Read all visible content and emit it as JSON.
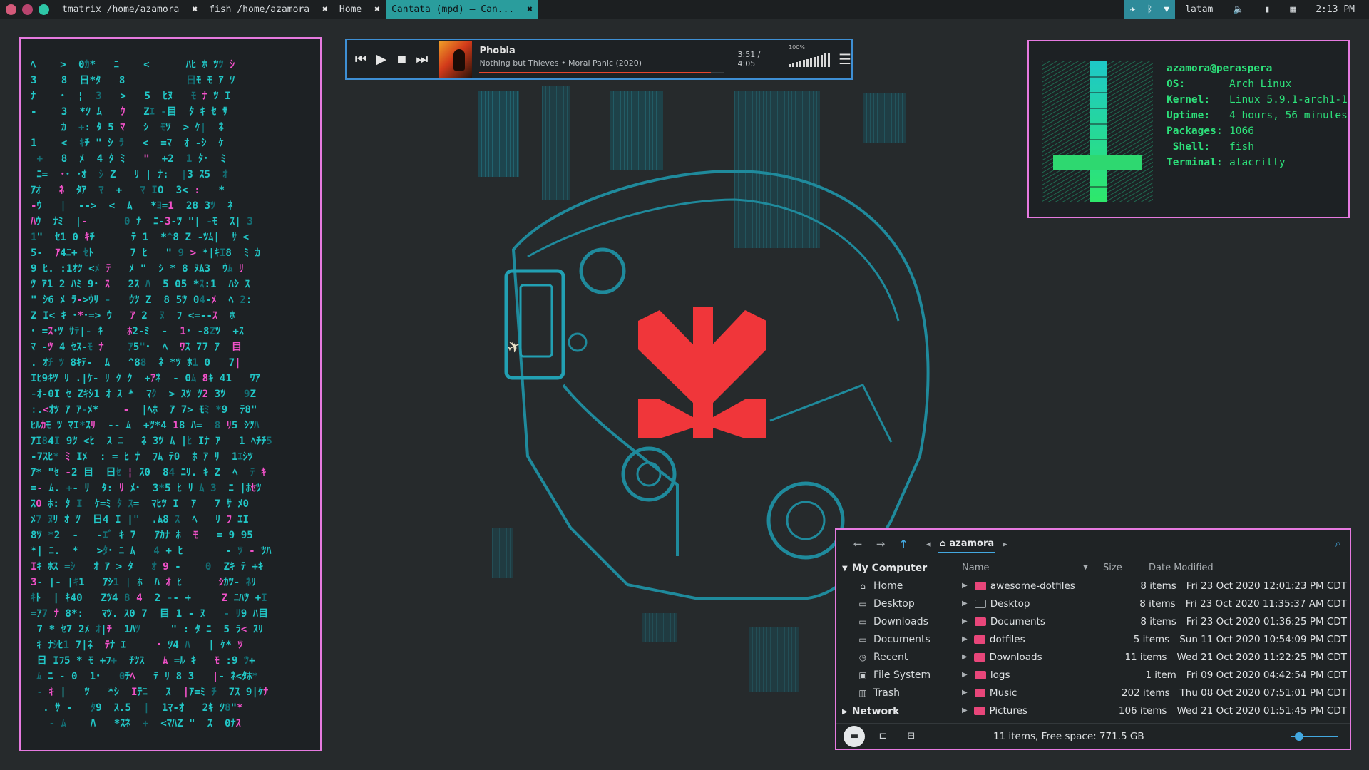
{
  "topbar": {
    "window_dots": [
      "#d45a7a",
      "#b8446e",
      "#2ec7a7"
    ],
    "tabs": [
      {
        "label": "tmatrix /home/azamora",
        "close": "✖",
        "active": false
      },
      {
        "label": "fish /home/azamora",
        "close": "✖",
        "active": false
      },
      {
        "label": "Home",
        "close": "✖",
        "active": false
      },
      {
        "label": "Cantata (mpd) – Can...",
        "close": "✖",
        "active": true
      }
    ],
    "tray": {
      "icons": [
        "telegram-icon",
        "bluetooth-icon",
        "wifi-icon"
      ],
      "keyboard": "latam",
      "time": "2:13 PM"
    }
  },
  "matrix": {
    "rows": [
      "ﾍ    >  0ｶ*   ﾆ    <      ﾊﾋ ﾎ ﾂﾂ ｼ",
      "3    8  日*ﾀ   8          日ﾓ ﾓ ｱ ﾂ",
      "ﾅ    ･  ¦  3   >   5  ﾋﾇ   ﾓ ﾅ ﾂ I",
      "-    3  *ﾂ ﾑ   ｳ   Zｴ -目  ﾀ ｷ ｾ ｻ",
      "     ｶ  +: ﾀ 5 ﾏ   ｼ  ﾓﾂ  > ｹ|  ﾈ",
      "1    <  ｷﾁ \" ｼ ﾗ   <  =ﾏ  ｵ -ｼ  ｹ",
      " +   8  ﾒ  4 ﾀ ﾐ   \"  +2  1 ﾀ･  ﾐ",
      " ﾆ=  ･･ ･ｵ  ｼ Z   ﾘ | ﾅ:  |3 ｽ5  ｵ",
      "ｱｵ   ﾈ  ﾀｱ  ﾏ  +   ﾏ IO  3< :   *",
      "-ｳ   |  -->  <  ﾑ   *ﾖ=1  28 3ﾂ  ﾈ",
      "ﾊｳ  ﾅﾐ  |-      0 ﾅ  ﾆ-3-ﾂ \"| -ﾓ  ｽ| 3",
      "1\"  ｾ1 0 ｷﾁ      ﾃ 1  *^8 Z -ﾂﾑ|  ｻ <",
      "5-  ｱ4ﾆ+ ｾﾄ      7 ﾋ   \" 9 > *|ｷI8  ﾐ ｶ",
      "9 ﾋ. :1ｵﾂ <ﾒ ﾃ   ﾒ \"  ｼ * 8 ﾇﾑ3  ｳﾑ ﾘ",
      "ﾂ ｱ1 2 ﾊﾐ 9･ ｽ   2ｽ ﾊ  5 05 *ｽ:1  ﾊｼ ｽ",
      "\" ｼ6 ﾒ ﾗ->ｳﾘ -   ｳﾂ Z  8 5ﾂ 04-ﾒ  ﾍ 2:",
      "Z I< ｷ ･*･=> ｳ   ｱ 2  ﾇ  ﾌ <=--ｽ  ﾎ",
      "･ =ｽ･ﾂ ｻﾃ|- ｷ    ﾎ2-ﾐ  -  1･ -8Zﾂ  +ｽ",
      "ﾏ -ﾂ 4 ｾｽ-ﾓ ﾅ    ｱ5\"･  ﾍ  ﾜｽ 77 ｱ  目",
      ". ｵﾁ ﾂ 8ｷﾃ-  ﾑ   ^88  ﾈ *ﾂ ﾎ1 0   7|",
      "Iﾋ9ｷﾂ ﾘ .|ｹ- ﾘ ｸ ｸ  +ｱﾈ  - 0ﾑ 8ｷ 41   ﾜｱ",
      "-ｵ-0I ｾ Zｷｼ1 ｵ ｽ *  ﾏｸ  > ｽﾂ ﾂ2 3ﾂ   9Z",
      ":.<ｵﾂ ｱ ｱ-ﾒ*    -  |ﾍﾎ  ｱ 7> ﾓﾐ *9  ﾃ8\"",
      "ﾋﾙｶﾓ ﾂ ﾏI*ｽﾘ  -- ﾑ  +ﾂ*4 18 ﾊ=  8 ﾘ5 ｼﾂﾊ",
      "ｱI84I 9ﾂ <ﾋ  ｽ ﾆ   ﾈ 3ﾂ ﾑ |ﾋ Iﾅ ｱ   1 ﾍﾁﾁ5",
      "-7ｽﾋ* ﾐ Iﾒ  : = ﾋ ﾅ  ﾌﾑ ﾃ0  ﾎ ｱ ﾘ  1ｴｼﾂ",
      "ｱ* \"ｾ -2 目  日ｾ ¦ ｽ0  84 ﾆﾘ. ｷ Z  ﾍ  ﾃ ｷ",
      "=- ﾑ. +- ﾘ  ﾀ: ﾘ ﾒ･  3*5 ﾋ ﾘ ﾑ 3  ﾆ |ﾎｾﾂ",
      "ｽ0 ﾎ: ﾀ I  ｹ=ﾐ ﾀ ｽ=  ﾏﾋﾂ I  ｱ   7 ｻ ﾒ0",
      "ﾒ7 ﾇﾘ ｵ ﾂ  日4 I |\"  .ﾑ8 ｽ  ﾍ   ﾘ ﾌ ｴI",
      "8ﾂ *2  -   -ｴﾞ ｷ 7   ｱｶﾅ ﾎ  ﾓ   = 9 95",
      "*| ﾆ.  *   >ﾀ･ ﾆ ﾑ   4 + ﾋ       - ﾂ - ﾂﾊ",
      "Iｷ ﾎｽ =ｼ   ｵ ｱ > ﾀ   ｵ 9 -    0  Zｷ ﾃ +ｷ",
      "3- |- |ｷ1   ｱｼ1 | ﾎ  ﾊ ｵ ﾋ      ｼｶﾂ- ﾈﾘ",
      "ｷﾄ  | ｷ40   Zﾂ4 8 4  2 -- +     Z ﾆﾊﾂ +I",
      "=ｱ7 ﾅ 8*:   ﾏﾂ. ｽ0 7  目 1 - ﾇ   - ﾘ9 ﾊ目",
      " 7 * ｾ7 2ﾒ ｵ|ﾁ  1ﾊﾂ     \" : ﾀ ﾆ  5 ﾗ< ｽﾘ",
      " ｷ ﾅｼﾋ1 7|ﾈ  ﾃﾅ ｴ     ･ ﾂ4 ﾊ   | ｹ* ﾂ",
      " 日 Iﾌ5 * ﾓ +ﾌ+  ﾁﾂｽ   ﾑ =ﾙ ｷ   ﾓ :9 ﾂ+",
      " ﾑ ﾆ - 0  1･   0ﾁﾍ   ﾃ ﾘ 8 3   |- ﾈ<ﾀﾎ*",
      " - ｷ |   ﾂ   *ｼ  Iﾃﾆ   ｽ  |ｱ=ﾐ ﾁ  7ｽ 9|ｹﾅ",
      "  . ｻ -   ﾀ9  ｽ.5  |  1ﾏ-ｵ   2ｷ ﾂ8\"*",
      "   - ﾑ    ﾊ   *ｽﾈ  +  <ﾏﾊZ \"  ｽ  0ﾅｽ"
    ]
  },
  "mpd": {
    "controls": [
      "previous-icon",
      "play-icon",
      "stop-icon",
      "next-icon"
    ],
    "title": "Phobia",
    "subtitle": "Nothing but Thieves • Moral Panic (2020)",
    "time": "3:51 / 4:05",
    "progress": 0.943,
    "volume_label": "100%",
    "volume": 1.0,
    "accent": "#e8452e"
  },
  "neofetch": {
    "user": "azamora@peraspera",
    "fields": [
      {
        "key": "OS:",
        "value": "Arch Linux"
      },
      {
        "key": "Kernel:",
        "value": "Linux 5.9.1-arch1-1"
      },
      {
        "key": "Uptime:",
        "value": "4 hours, 56 minutes"
      },
      {
        "key": "Packages:",
        "value": "1066"
      },
      {
        "key": " Shell:",
        "value": " fish"
      },
      {
        "key": "Terminal:",
        "value": "alacritty"
      }
    ]
  },
  "filemanager": {
    "breadcrumb": "azamora",
    "sidebar_section": "My Computer",
    "sidebar_items": [
      {
        "icon": "home-icon",
        "label": "Home"
      },
      {
        "icon": "desktop-icon",
        "label": "Desktop"
      },
      {
        "icon": "folder-icon",
        "label": "Downloads"
      },
      {
        "icon": "folder-icon",
        "label": "Documents"
      },
      {
        "icon": "recent-icon",
        "label": "Recent"
      },
      {
        "icon": "drive-icon",
        "label": "File System"
      },
      {
        "icon": "trash-icon",
        "label": "Trash"
      }
    ],
    "network_label": "Network",
    "columns": {
      "name": "Name",
      "size": "Size",
      "date": "Date Modified"
    },
    "rows": [
      {
        "name": "awesome-dotfiles",
        "size": "8 items",
        "date": "Fri 23 Oct 2020 12:01:23 PM CDT",
        "icon": "folder"
      },
      {
        "name": "Desktop",
        "size": "8 items",
        "date": "Fri 23 Oct 2020 11:35:37 AM CDT",
        "icon": "desktop"
      },
      {
        "name": "Documents",
        "size": "8 items",
        "date": "Fri 23 Oct 2020 01:36:25 PM CDT",
        "icon": "folder"
      },
      {
        "name": "dotfiles",
        "size": "5 items",
        "date": "Sun 11 Oct 2020 10:54:09 PM CDT",
        "icon": "folder"
      },
      {
        "name": "Downloads",
        "size": "11 items",
        "date": "Wed 21 Oct 2020 11:22:25 PM CDT",
        "icon": "folder"
      },
      {
        "name": "logs",
        "size": "1 item",
        "date": "Fri 09 Oct 2020 04:42:54 PM CDT",
        "icon": "folder"
      },
      {
        "name": "Music",
        "size": "202 items",
        "date": "Thu 08 Oct 2020 07:51:01 PM CDT",
        "icon": "folder"
      },
      {
        "name": "Pictures",
        "size": "106 items",
        "date": "Wed 21 Oct 2020 01:51:45 PM CDT",
        "icon": "folder"
      }
    ],
    "status": "11 items, Free space: 771.5 GB",
    "zoom": 0.1
  }
}
